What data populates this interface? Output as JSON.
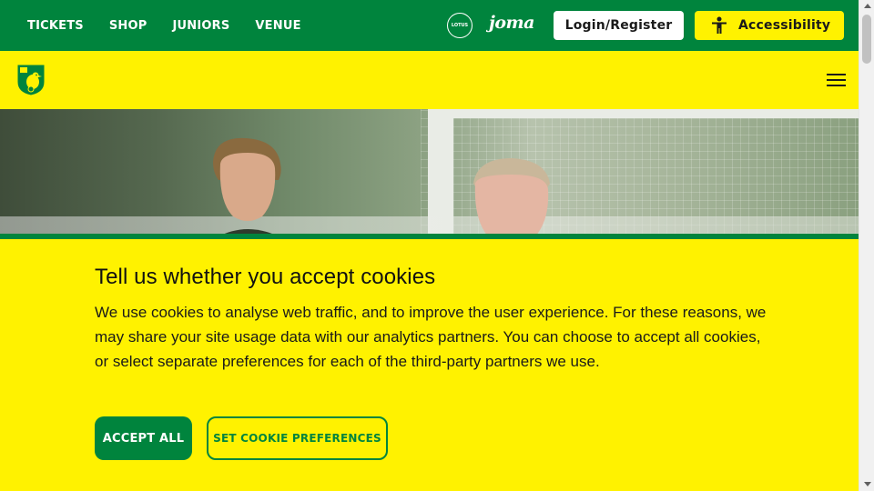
{
  "topbar": {
    "nav": [
      "TICKETS",
      "SHOP",
      "JUNIORS",
      "VENUE"
    ],
    "sponsors": {
      "lotus": "LOTUS",
      "joma": "joma"
    },
    "login_label": "Login/Register",
    "accessibility_label": "Accessibility",
    "accessibility_icon": "person-accessibility-icon"
  },
  "header": {
    "crest_icon": "club-crest-icon",
    "menu_icon": "hamburger-menu-icon"
  },
  "cookie": {
    "title": "Tell us whether you accept cookies",
    "body": "We use cookies to analyse web traffic, and to improve the user experience. For these reasons, we may share your site usage data with our analytics partners. You can choose to accept all cookies, or select separate preferences for each of the third-party partners we use.",
    "accept_label": "ACCEPT ALL",
    "prefs_label": "SET COOKIE PREFERENCES"
  },
  "colors": {
    "green": "#00843d",
    "yellow": "#fff200"
  }
}
